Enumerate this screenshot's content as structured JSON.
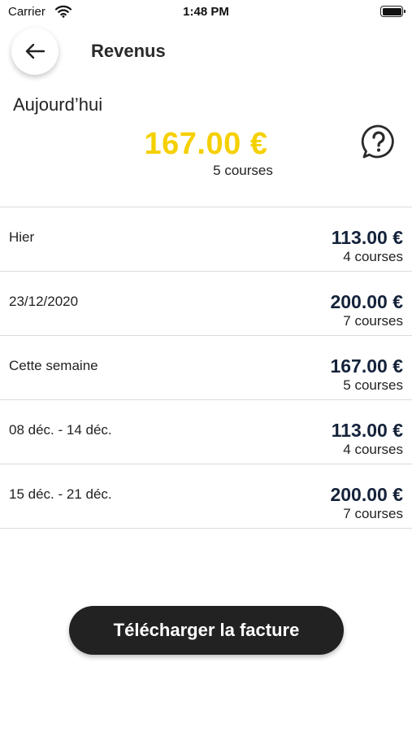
{
  "status_bar": {
    "carrier": "Carrier",
    "time": "1:48 PM"
  },
  "header": {
    "title": "Revenus",
    "back_icon": "arrow-left-icon"
  },
  "today": {
    "label": "Aujourd’hui",
    "amount": "167.00 €",
    "count": "5 courses",
    "help_icon": "question-bubble-icon"
  },
  "rows": [
    {
      "label": "Hier",
      "amount": "113.00 €",
      "count": "4 courses"
    },
    {
      "label": "23/12/2020",
      "amount": "200.00 €",
      "count": "7 courses"
    },
    {
      "label": "Cette semaine",
      "amount": "167.00 €",
      "count": "5 courses"
    },
    {
      "label": "08 déc. - 14 déc.",
      "amount": "113.00 €",
      "count": "4 courses"
    },
    {
      "label": "15 déc. - 21 déc.",
      "amount": "200.00 €",
      "count": "7 courses"
    }
  ],
  "download_button": {
    "label": "Télécharger la facture"
  },
  "colors": {
    "accent_yellow": "#f5d000",
    "amount_navy": "#15233b",
    "button_dark": "#222222"
  }
}
